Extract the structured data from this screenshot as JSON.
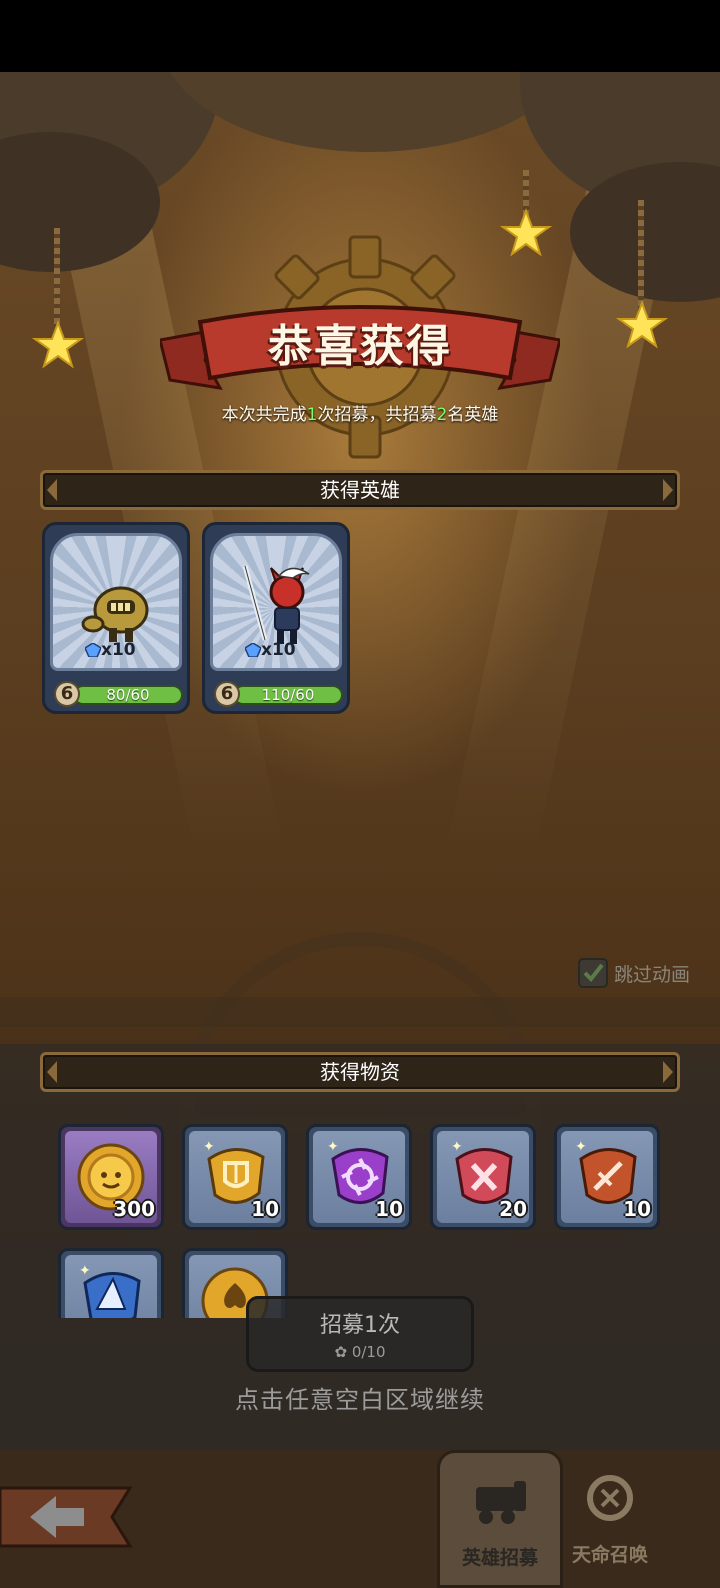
{
  "title": "恭喜获得",
  "summary": {
    "prefix": "本次共完成",
    "times": "1",
    "middle": "次招募，共招募",
    "heroes": "2",
    "suffix": "名英雄"
  },
  "heroes_section": {
    "label": "获得英雄",
    "cards": [
      {
        "qty": "x10",
        "level": "6",
        "progress": "80/60"
      },
      {
        "qty": "x10",
        "level": "6",
        "progress": "110/60"
      }
    ]
  },
  "items_section": {
    "label": "获得物资",
    "items": [
      {
        "icon": "gold-coin-icon",
        "count": "300"
      },
      {
        "icon": "shield-rune-icon",
        "count": "10"
      },
      {
        "icon": "shuriken-rune-icon",
        "count": "10"
      },
      {
        "icon": "cross-rune-icon",
        "count": "20"
      },
      {
        "icon": "sword-rune-icon",
        "count": "10"
      },
      {
        "icon": "hat-rune-icon",
        "count": ""
      },
      {
        "icon": "spade-coin-icon",
        "count": ""
      }
    ]
  },
  "skip_animation": "跳过动画",
  "recruit_button": {
    "label": "招募1次",
    "cost": "0/10"
  },
  "continue_hint": "点击任意空白区域继续",
  "tabs": {
    "hero_recruit": "英雄招募",
    "fate_summon": "天命召唤"
  },
  "colors": {
    "accent_green": "#7cff6a",
    "progress_green": "#6fbf44",
    "banner_red": "#b83a2c"
  }
}
